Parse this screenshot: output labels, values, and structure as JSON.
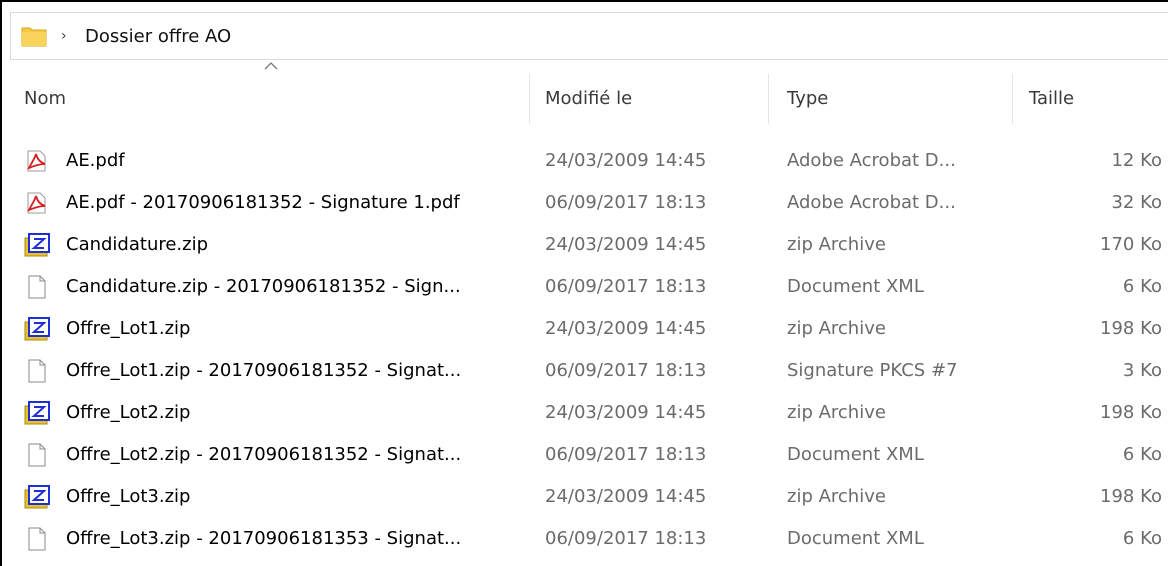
{
  "address_bar": {
    "folder_icon": "folder-icon",
    "chevron": "›",
    "path": "Dossier offre AO"
  },
  "columns": {
    "name": "Nom",
    "modified": "Modifié le",
    "type": "Type",
    "size": "Taille"
  },
  "files": [
    {
      "icon": "pdf-icon",
      "name": "AE.pdf",
      "modified": "24/03/2009 14:45",
      "type": "Adobe Acrobat D...",
      "size": "12 Ko"
    },
    {
      "icon": "pdf-icon",
      "name": "AE.pdf - 20170906181352 - Signature 1.pdf",
      "modified": "06/09/2017 18:13",
      "type": "Adobe Acrobat D...",
      "size": "32 Ko"
    },
    {
      "icon": "zip-icon",
      "name": "Candidature.zip",
      "modified": "24/03/2009 14:45",
      "type": "zip Archive",
      "size": "170 Ko"
    },
    {
      "icon": "document-icon",
      "name": "Candidature.zip - 20170906181352 - Sign...",
      "modified": "06/09/2017 18:13",
      "type": "Document XML",
      "size": "6 Ko"
    },
    {
      "icon": "zip-icon",
      "name": "Offre_Lot1.zip",
      "modified": "24/03/2009 14:45",
      "type": "zip Archive",
      "size": "198 Ko"
    },
    {
      "icon": "document-icon",
      "name": "Offre_Lot1.zip - 20170906181352 - Signat...",
      "modified": "06/09/2017 18:13",
      "type": "Signature PKCS #7",
      "size": "3 Ko"
    },
    {
      "icon": "zip-icon",
      "name": "Offre_Lot2.zip",
      "modified": "24/03/2009 14:45",
      "type": "zip Archive",
      "size": "198 Ko"
    },
    {
      "icon": "document-icon",
      "name": "Offre_Lot2.zip - 20170906181352 - Signat...",
      "modified": "06/09/2017 18:13",
      "type": "Document XML",
      "size": "6 Ko"
    },
    {
      "icon": "zip-icon",
      "name": "Offre_Lot3.zip",
      "modified": "24/03/2009 14:45",
      "type": "zip Archive",
      "size": "198 Ko"
    },
    {
      "icon": "document-icon",
      "name": "Offre_Lot3.zip - 20170906181353 - Signat...",
      "modified": "06/09/2017 18:13",
      "type": "Document XML",
      "size": "6 Ko"
    }
  ],
  "colors": {
    "folder": "#f5c842",
    "pdf_red": "#d81e1e",
    "zip_blue": "#1f2fd6",
    "zip_yellow": "#e8c22a",
    "secondary_text": "#6b6b6b"
  }
}
